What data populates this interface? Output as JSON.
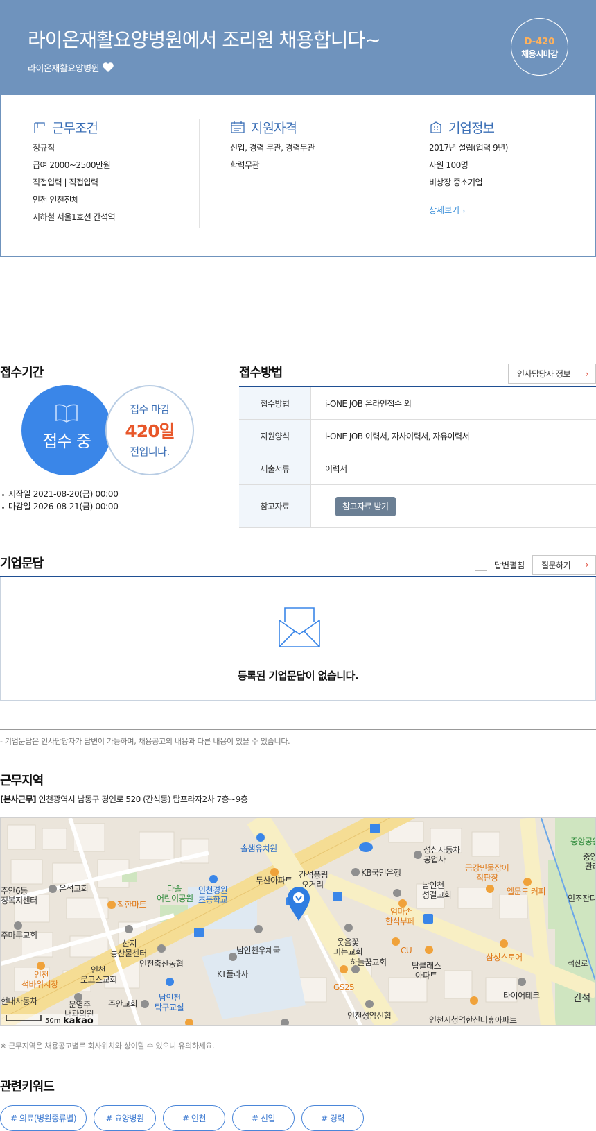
{
  "header": {
    "title": "라이온재활요양병원에서 조리원 채용합니다~",
    "company": "라이온재활요양병원",
    "dday": "D-420",
    "deadline_type": "채용시마감"
  },
  "summary": {
    "work": {
      "title": "근무조건",
      "items": [
        "정규직",
        "급여 2000~2500만원",
        "직접입력 | 직접입력",
        "인천 인천전체",
        "지하철 서울1호선 간석역"
      ]
    },
    "qualify": {
      "title": "지원자격",
      "items": [
        "신입, 경력 무관, 경력무관",
        "학력무관"
      ]
    },
    "company": {
      "title": "기업정보",
      "items": [
        "2017년 설립(업력 9년)",
        "사원 100명",
        "비상장 중소기업"
      ],
      "more": "상세보기"
    }
  },
  "period": {
    "title": "접수기간",
    "status": "접수 중",
    "deadline_label": "접수 마감",
    "days": "420일",
    "days_suffix": "전입니다.",
    "start": "시작일 2021-08-20(금) 00:00",
    "end": "마감일 2026-08-21(금) 00:00"
  },
  "method": {
    "title": "접수방법",
    "hr_button": "인사담당자 정보",
    "rows": [
      {
        "label": "접수방법",
        "value": "i-ONE JOB 온라인접수 외"
      },
      {
        "label": "지원양식",
        "value": "i-ONE JOB 이력서, 자사이력서, 자유이력서"
      },
      {
        "label": "제출서류",
        "value": "이력서"
      },
      {
        "label": "참고자료",
        "value": "참고자료 받기"
      }
    ]
  },
  "qa": {
    "title": "기업문답",
    "unfold_label": "답변펼침",
    "ask_button": "질문하기",
    "empty": "등록된 기업문답이 없습니다.",
    "note": "- 기업문답은 인사담당자가 답변이 가능하며, 채용공고의 내용과 다른 내용이 있을 수 있습니다."
  },
  "location": {
    "title": "근무지역",
    "tag": "[본사근무]",
    "address": "인천광역시 남동구 경인로 520 (간석동) 탑프라자2차 7층~9층",
    "note": "※ 근무지역은 채용공고별로 회사위치와 상이할 수 있으니 유의하세요.",
    "map": {
      "scale": "50m",
      "brand": "kakao",
      "labels": {
        "l1": "솔샘유치원",
        "l2": "두산아파트",
        "l3": "간석풍림",
        "l3b": "오거리",
        "l4": "KB국민은행",
        "l5": "성심자동차",
        "l5b": "공업사",
        "l6": "금강민물장어",
        "l6b": "직판장",
        "l7": "엘문도 커피",
        "l8": "남인천",
        "l8b": "성결교회",
        "l9": "엄마손",
        "l9b": "한식부페",
        "l10": "착한마트",
        "l11": "다솔",
        "l11b": "어린이공원",
        "l12": "인천경원",
        "l12b": "초등학교",
        "l13": "은석교회",
        "l14": "산지",
        "l14b": "농산물센터",
        "l15": "인천축산농협",
        "l16": "남인천우체국",
        "l17": "웃음꽃",
        "l17b": "피는교회",
        "l18": "CU",
        "l19": "하늘꿈교회",
        "l20": "탑클래스",
        "l20b": "아파트",
        "l21": "삼성스토어",
        "l22": "KT플라자",
        "l23": "GS25",
        "l24": "인천",
        "l24b": "로고스교회",
        "l25": "주안교회",
        "l26": "남인천",
        "l26b": "탁구교실",
        "l27": "인천성암신협",
        "l28": "인천시청역한신더휴아파트",
        "l29": "타이어테크",
        "l30": "석산로",
        "l31": "간석",
        "l32": "중앙공원",
        "l33": "인조잔디",
        "l34": "주안6동",
        "l34b": "정복지센터",
        "l35": "주마루교회",
        "l36": "인천",
        "l36b": "석바위시장",
        "l37": "현대자동차",
        "l38": "문영주",
        "l38b": "내과의원",
        "l39": "중앙",
        "l39b": "관리"
      }
    }
  },
  "keywords": {
    "title": "관련키워드",
    "items": [
      "# 의료(병원종류별)",
      "# 요양병원",
      "# 인천",
      "# 신입",
      "# 경력"
    ]
  },
  "colors": {
    "header_bg": "#6f93bd",
    "accent_blue": "#3a86e8",
    "accent_orange": "#e8572a",
    "line_navy": "#1f4f93"
  }
}
